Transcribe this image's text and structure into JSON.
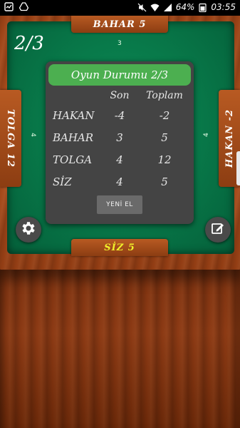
{
  "status_bar": {
    "battery": "64%",
    "time": "03:55"
  },
  "game": {
    "round": "2/3",
    "players": {
      "top": "BAHAR 5",
      "left": "TOLGA 12",
      "right": "HAKAN -2",
      "bottom": "SİZ 5"
    },
    "bids": {
      "top": "3",
      "left": "4",
      "right": "4"
    },
    "colors": {
      "felt": "#087a4a",
      "dialog_header": "#4caf50",
      "self_name": "#f0f02a"
    }
  },
  "dialog": {
    "title": "Oyun Durumu 2/3",
    "columns": [
      "Son",
      "Toplam"
    ],
    "rows": [
      {
        "name": "HAKAN",
        "son": "-4",
        "toplam": "-2"
      },
      {
        "name": "BAHAR",
        "son": "3",
        "toplam": "5"
      },
      {
        "name": "TOLGA",
        "son": "4",
        "toplam": "12"
      },
      {
        "name": "SİZ",
        "son": "4",
        "toplam": "5"
      }
    ],
    "new_hand_label": "YENİ EL"
  },
  "icons": {
    "settings": "gear-icon",
    "edit": "edit-icon"
  }
}
